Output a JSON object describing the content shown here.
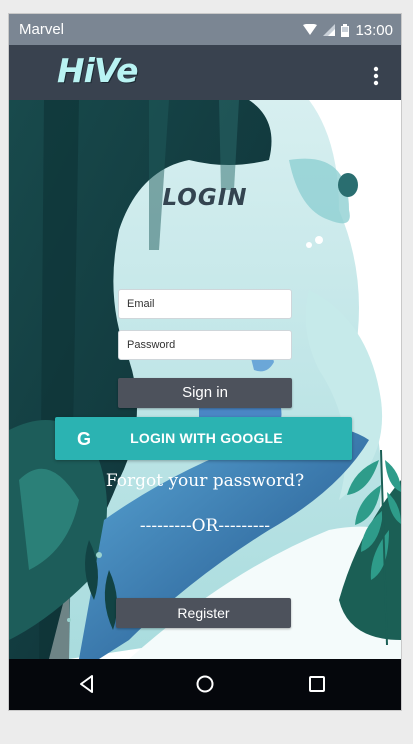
{
  "status_bar": {
    "carrier": "Marvel",
    "time": "13:00"
  },
  "app_bar": {
    "logo_text": "HiVe"
  },
  "login": {
    "title": "LOGIN",
    "email_placeholder": "Email",
    "password_placeholder": "Password",
    "signin_label": "Sign in",
    "google_icon_letter": "G",
    "google_label": "LOGIN WITH GOOGLE",
    "forgot_label": "Forgot your password?",
    "divider_label": "---------OR---------",
    "register_label": "Register"
  },
  "nav_bar": {
    "back_icon": "back-icon",
    "home_icon": "home-icon",
    "recents_icon": "recents-icon"
  },
  "colors": {
    "status_bar": "#7b8693",
    "app_bar": "#39424f",
    "accent": "#2bb3b2",
    "button_dark": "#4d525c",
    "nav_bar": "#05070c"
  }
}
